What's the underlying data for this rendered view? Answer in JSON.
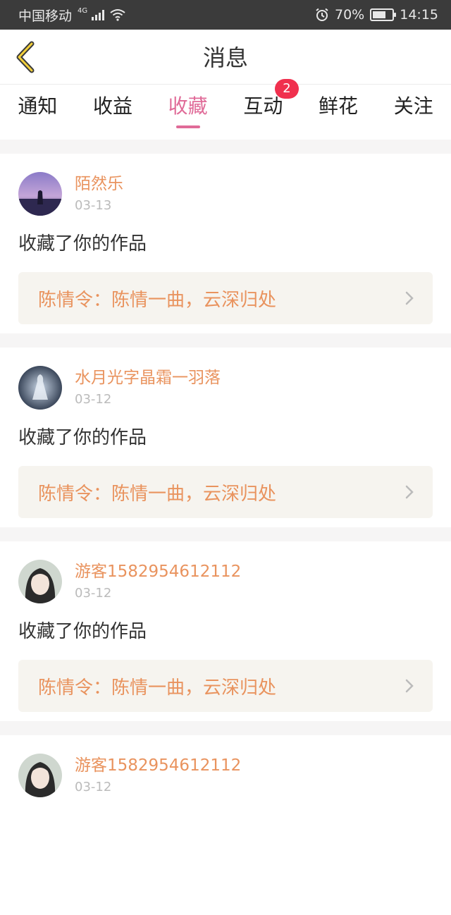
{
  "status_bar": {
    "carrier": "中国移动",
    "network": "4G",
    "battery": "70%",
    "battery_level": 0.7,
    "time": "14:15"
  },
  "header": {
    "title": "消息"
  },
  "tabs": [
    {
      "label": "通知"
    },
    {
      "label": "收益"
    },
    {
      "label": "收藏",
      "active": true
    },
    {
      "label": "互动",
      "badge": "2"
    },
    {
      "label": "鲜花"
    },
    {
      "label": "关注"
    }
  ],
  "colors": {
    "accent_pink": "#e06b98",
    "accent_orange": "#e9935e",
    "badge_red": "#f0304e"
  },
  "messages": [
    {
      "username": "陌然乐",
      "date": "03-13",
      "action": "收藏了你的作品",
      "work": "陈情令：陈情一曲，云深归处"
    },
    {
      "username": "水月光字晶霜一羽落",
      "date": "03-12",
      "action": "收藏了你的作品",
      "work": "陈情令：陈情一曲，云深归处"
    },
    {
      "username": "游客1582954612112",
      "date": "03-12",
      "action": "收藏了你的作品",
      "work": "陈情令：陈情一曲，云深归处"
    },
    {
      "username": "游客1582954612112",
      "date": "03-12",
      "action": "",
      "work": ""
    }
  ]
}
